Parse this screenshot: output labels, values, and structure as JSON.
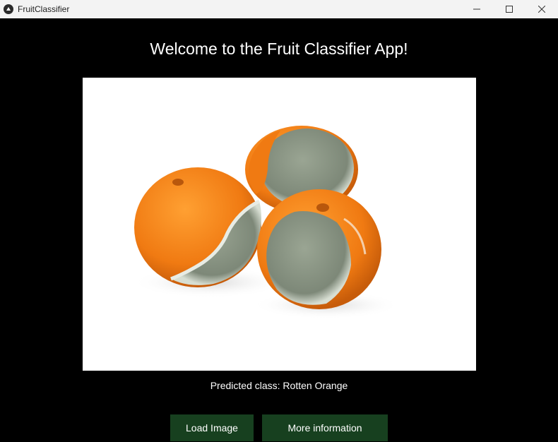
{
  "window": {
    "title": "FruitClassifier",
    "icon": "app-icon",
    "controls": [
      "minimize-icon",
      "maximize-icon",
      "close-icon"
    ]
  },
  "main": {
    "heading": "Welcome to the Fruit Classifier App!",
    "image_description_icon": "photo of three oranges",
    "prediction": "Predicted class: Rotten Orange",
    "buttons": {
      "load_label": "Load Image",
      "info_label": "More information"
    }
  },
  "colors": {
    "background": "#000000",
    "titlebar": "#f3f3f3",
    "button": "#17401f",
    "text": "#ffffff"
  }
}
